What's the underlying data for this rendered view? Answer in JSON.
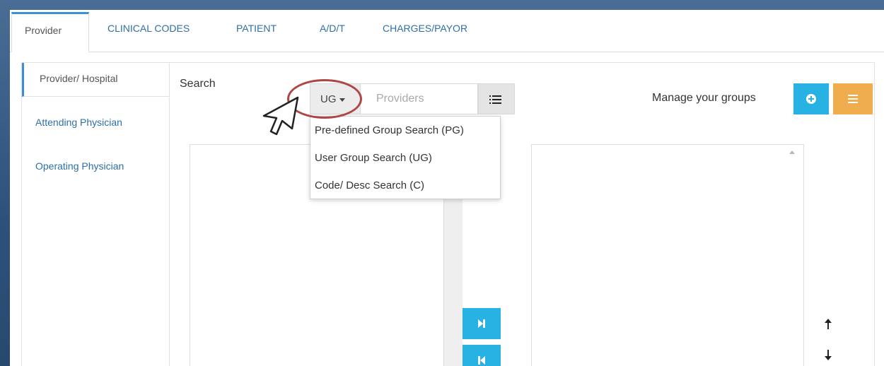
{
  "top_tabs": {
    "provider": "Provider",
    "clinical_codes": "CLINICAL CODES",
    "patient": "PATIENT",
    "adt": "A/D/T",
    "charges_payor": "CHARGES/PAYOR"
  },
  "side_tabs": {
    "provider_hospital": "Provider/ Hospital",
    "attending_physician": "Attending Physician",
    "operating_physician": "Operating Physician"
  },
  "search": {
    "label": "Search",
    "mode_selected": "UG",
    "placeholder": "Providers"
  },
  "dropdown": {
    "items": [
      "Pre-defined Group Search (PG)",
      "User Group Search (UG)",
      "Code/ Desc Search (C)"
    ]
  },
  "groups": {
    "label": "Manage your groups"
  },
  "icons": {
    "add": "plus-circle-icon",
    "groups_menu": "list-icon",
    "search_list": "list-icon",
    "move_right": "step-forward-icon",
    "move_left": "step-backward-icon",
    "move_up": "arrow-up-icon",
    "move_down": "arrow-down-icon",
    "pointer": "cursor-arrow-icon"
  },
  "colors": {
    "accent_blue": "#27b2e3",
    "accent_orange": "#f0ad4e",
    "link_blue": "#2e6fa8",
    "highlight_ellipse": "#b04545"
  }
}
